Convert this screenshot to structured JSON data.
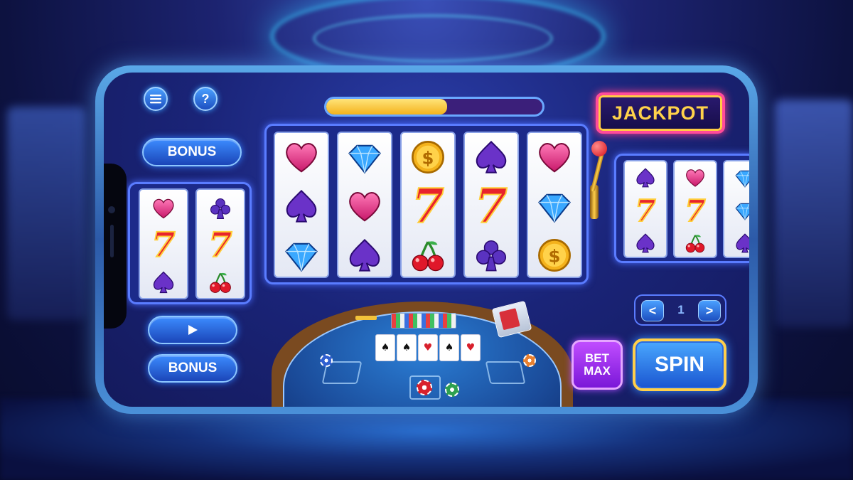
{
  "top_bar": {
    "menu_icon": "hamburger-menu-icon",
    "help_label": "?",
    "progress": 0.56
  },
  "jackpot": {
    "label": "JACKPOT"
  },
  "left_panel": {
    "bonus_top_label": "BONUS",
    "play_icon": "play-icon",
    "bonus_bottom_label": "BONUS"
  },
  "main_reels": [
    [
      "heart",
      "spade",
      "diamond"
    ],
    [
      "diamond",
      "heart",
      "spade"
    ],
    [
      "coin",
      "seven",
      "cherry"
    ],
    [
      "spade",
      "seven",
      "club"
    ],
    [
      "heart",
      "diamond",
      "coin"
    ]
  ],
  "left_reels": [
    [
      "heart",
      "seven",
      "spade"
    ],
    [
      "club",
      "seven",
      "cherry"
    ]
  ],
  "right_reels": [
    [
      "spade",
      "seven",
      "spade"
    ],
    [
      "heart",
      "seven",
      "cherry"
    ],
    [
      "diamond",
      "diamond",
      "spade"
    ]
  ],
  "symbols": {
    "seven": "7",
    "coin": "$"
  },
  "pager": {
    "prev": "<",
    "page": "1",
    "next": ">"
  },
  "controls": {
    "bet_max_line1": "BET",
    "bet_max_line2": "MAX",
    "spin_label": "SPIN"
  },
  "table_cards": [
    "♠",
    "♠",
    "♥",
    "♠",
    "♥"
  ],
  "colors": {
    "accent": "#3c8cff",
    "jackpot_text": "#ffd24a",
    "bet_max": "#a030f0"
  }
}
